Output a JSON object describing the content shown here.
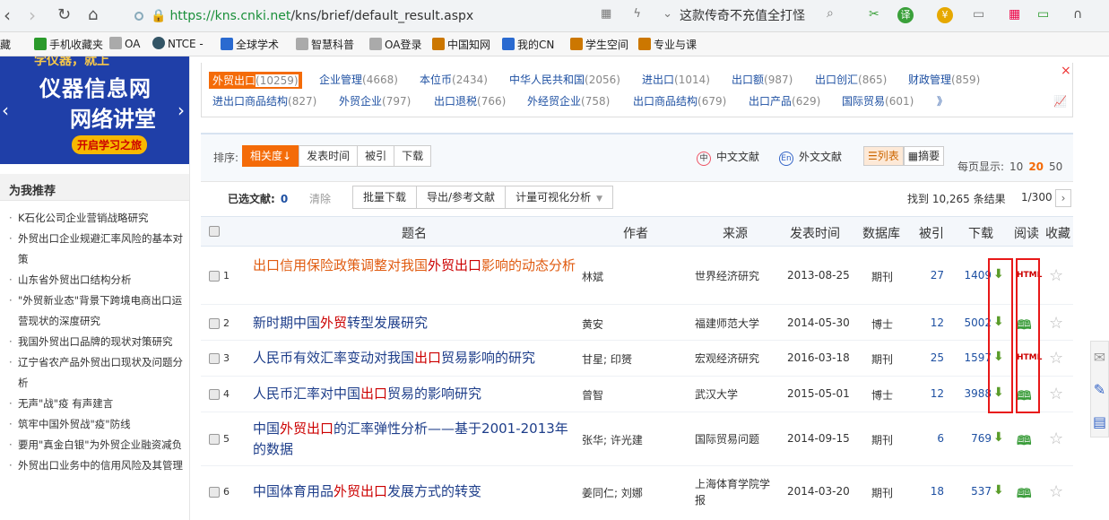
{
  "browser": {
    "url_prefix": "https://",
    "url_domain": "kns.cnki.net",
    "url_path": "/kns/brief/default_result.aspx",
    "search_suggestion": "这款传奇不充值全打怪"
  },
  "bookmarks": [
    {
      "label": "藏",
      "color": "#777"
    },
    {
      "label": "手机收藏夹",
      "color": "#2a9a2a"
    },
    {
      "label": "OA",
      "color": "#999"
    },
    {
      "label": "NTCE -",
      "color": "#356"
    },
    {
      "label": "全球学术",
      "color": "#2a6ad0"
    },
    {
      "label": "智慧科普",
      "color": "#999"
    },
    {
      "label": "OA登录",
      "color": "#999"
    },
    {
      "label": "中国知网",
      "color": "#c70"
    },
    {
      "label": "我的CN",
      "color": "#2a6ad0"
    },
    {
      "label": "学生空间",
      "color": "#c70"
    },
    {
      "label": "专业与课",
      "color": "#c70"
    }
  ],
  "banner": {
    "line0": "学仪器，就上",
    "line1": "仪器信息网",
    "line2": "网络讲堂",
    "cta": "开启学习之旅"
  },
  "sidebar": {
    "title": "为我推荐",
    "items": [
      "K石化公司企业营销战略研究",
      "外贸出口企业规避汇率风险的基本对策",
      "山东省外贸出口结构分析",
      "\"外贸新业态\"背景下跨境电商出口运营现状的深度研究",
      "我国外贸出口品牌的现状对策研究",
      "辽宁省农产品外贸出口现状及问题分析",
      "无声\"战\"疫 有声建言",
      "筑牢中国外贸战\"疫\"防线",
      "要用\"真金白银\"为外贸企业融资减负",
      "外贸出口业务中的信用风险及其管理"
    ]
  },
  "topics": {
    "row1": [
      {
        "label": "外贸出口",
        "count": "(10259)",
        "selected": true
      },
      {
        "label": "企业管理",
        "count": "(4668)"
      },
      {
        "label": "本位币",
        "count": "(2434)"
      },
      {
        "label": "中华人民共和国",
        "count": "(2056)"
      },
      {
        "label": "进出口",
        "count": "(1014)"
      },
      {
        "label": "出口额",
        "count": "(987)"
      },
      {
        "label": "出口创汇",
        "count": "(865)"
      },
      {
        "label": "财政管理",
        "count": "(859)"
      }
    ],
    "row2": [
      {
        "label": "进出口商品结构",
        "count": "(827)"
      },
      {
        "label": "外贸企业",
        "count": "(797)"
      },
      {
        "label": "出口退税",
        "count": "(766)"
      },
      {
        "label": "外经贸企业",
        "count": "(758)"
      },
      {
        "label": "出口商品结构",
        "count": "(679)"
      },
      {
        "label": "出口产品",
        "count": "(629)"
      },
      {
        "label": "国际贸易",
        "count": "(601)"
      }
    ],
    "more": "》",
    "close": "×"
  },
  "toolbar": {
    "sort_label": "排序:",
    "sort_options": [
      "相关度↓",
      "发表时间",
      "被引",
      "下载"
    ],
    "chinese_docs": "中文文献",
    "foreign_docs": "外文文献",
    "view_list": "☰列表",
    "view_abstract": "▦摘要",
    "per_page_label": "每页显示:",
    "per_page": [
      "10",
      "20",
      "50"
    ],
    "per_page_selected": "20"
  },
  "selection": {
    "label": "已选文献:",
    "count": "0",
    "clear": "清除",
    "bulk_download": "批量下载",
    "export": "导出/参考文献",
    "visual": "计量可视化分析",
    "found": "找到 10,265 条结果",
    "page": "1/300",
    "next": "›"
  },
  "table": {
    "headers": [
      "题名",
      "作者",
      "来源",
      "发表时间",
      "数据库",
      "被引",
      "下载",
      "阅读",
      "收藏"
    ],
    "rows": [
      {
        "num": "1",
        "title": [
          [
            "hl2",
            "出口"
          ],
          [
            "hl2",
            "信用保险政策调整对我国"
          ],
          [
            "hl",
            "外贸出口"
          ],
          [
            "hl2",
            "影响的动态分析"
          ]
        ],
        "author": "林斌",
        "source": "世界经济研究",
        "date": "2013-08-25",
        "db": "期刊",
        "cite": "27",
        "downloads": "1409",
        "read": "HTML"
      },
      {
        "num": "2",
        "title": [
          [
            "",
            "新时期中国"
          ],
          [
            "hl",
            "外贸"
          ],
          [
            "",
            "转型发展研究"
          ]
        ],
        "author": "黄安",
        "source": "福建师范大学",
        "date": "2014-05-30",
        "db": "博士",
        "cite": "12",
        "downloads": "5002",
        "read": "book"
      },
      {
        "num": "3",
        "title": [
          [
            "",
            "人民币有效汇率变动对我国"
          ],
          [
            "hl",
            "出口"
          ],
          [
            "",
            "贸易影响的研究"
          ]
        ],
        "author": "甘星; 印赟",
        "source": "宏观经济研究",
        "date": "2016-03-18",
        "db": "期刊",
        "cite": "25",
        "downloads": "1597",
        "read": "HTML"
      },
      {
        "num": "4",
        "title": [
          [
            "",
            "人民币汇率对中国"
          ],
          [
            "hl",
            "出口"
          ],
          [
            "",
            "贸易的影响研究"
          ]
        ],
        "author": "曾智",
        "source": "武汉大学",
        "date": "2015-05-01",
        "db": "博士",
        "cite": "12",
        "downloads": "3988",
        "read": "book"
      },
      {
        "num": "5",
        "title": [
          [
            "",
            "中国"
          ],
          [
            "hl",
            "外贸出口"
          ],
          [
            "",
            "的汇率弹性分析——基于2001-2013年的数据"
          ]
        ],
        "author": "张华; 许光建",
        "source": "国际贸易问题",
        "date": "2014-09-15",
        "db": "期刊",
        "cite": "6",
        "downloads": "769",
        "read": "book"
      },
      {
        "num": "6",
        "title": [
          [
            "",
            "中国体育用品"
          ],
          [
            "hl",
            "外贸出口"
          ],
          [
            "",
            "发展方式的转变"
          ]
        ],
        "author": "姜同仁; 刘娜",
        "source": "上海体育学院学报",
        "date": "2014-03-20",
        "db": "期刊",
        "cite": "18",
        "downloads": "537",
        "read": "book"
      }
    ]
  }
}
